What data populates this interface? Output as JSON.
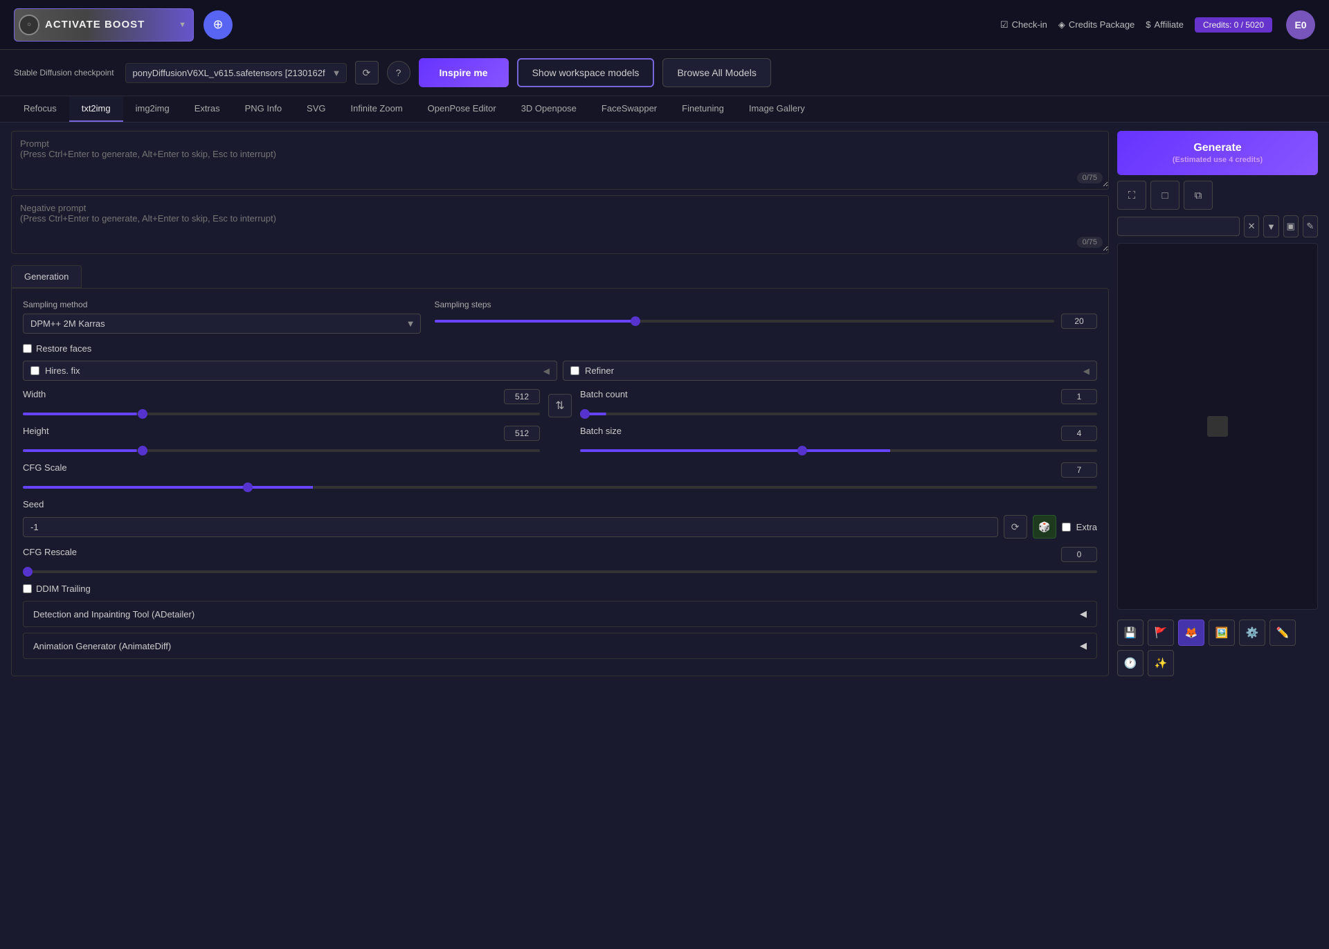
{
  "topbar": {
    "boost_label": "ACTIVATE BOOST",
    "discord_icon": "D",
    "checkin_label": "Check-in",
    "credits_package_label": "Credits Package",
    "affiliate_label": "Affiliate",
    "credits_label": "Credits: 0 / 5020",
    "avatar_label": "E0"
  },
  "checkpoint": {
    "label": "Stable Diffusion checkpoint",
    "value": "ponyDiffusionV6XL_v615.safetensors [2130162f",
    "inspire_label": "Inspire me",
    "workspace_label": "Show workspace models",
    "browse_label": "Browse All Models"
  },
  "tabs": [
    {
      "id": "refocus",
      "label": "Refocus"
    },
    {
      "id": "txt2img",
      "label": "txt2img",
      "active": true
    },
    {
      "id": "img2img",
      "label": "img2img"
    },
    {
      "id": "extras",
      "label": "Extras"
    },
    {
      "id": "pnginfo",
      "label": "PNG Info"
    },
    {
      "id": "svg",
      "label": "SVG"
    },
    {
      "id": "infinitezoom",
      "label": "Infinite Zoom"
    },
    {
      "id": "openpose",
      "label": "OpenPose Editor"
    },
    {
      "id": "3dopenpose",
      "label": "3D Openpose"
    },
    {
      "id": "faceswapper",
      "label": "FaceSwapper"
    },
    {
      "id": "finetuning",
      "label": "Finetuning"
    },
    {
      "id": "imagegallery",
      "label": "Image Gallery"
    }
  ],
  "prompt": {
    "placeholder": "Prompt\n(Press Ctrl+Enter to generate, Alt+Enter to skip, Esc to interrupt)",
    "counter": "0/75"
  },
  "negative_prompt": {
    "placeholder": "Negative prompt\n(Press Ctrl+Enter to generate, Alt+Enter to skip, Esc to interrupt)",
    "counter": "0/75"
  },
  "generation": {
    "section_label": "Generation",
    "sampling_method_label": "Sampling method",
    "sampling_method_value": "DPM++ 2M Karras",
    "sampling_steps_label": "Sampling steps",
    "sampling_steps_value": "20",
    "sampling_steps_pct": "33",
    "restore_faces_label": "Restore faces",
    "hires_label": "Hires. fix",
    "refiner_label": "Refiner",
    "width_label": "Width",
    "width_value": "512",
    "width_pct": "20",
    "height_label": "Height",
    "height_value": "512",
    "height_pct": "20",
    "batch_count_label": "Batch count",
    "batch_count_value": "1",
    "batch_count_pct": "5",
    "batch_size_label": "Batch size",
    "batch_size_value": "4",
    "batch_size_pct": "60",
    "cfg_scale_label": "CFG Scale",
    "cfg_scale_value": "7",
    "cfg_scale_pct": "27",
    "seed_label": "Seed",
    "seed_value": "-1",
    "extra_label": "Extra",
    "cfg_rescale_label": "CFG Rescale",
    "cfg_rescale_value": "0",
    "cfg_rescale_pct": "0",
    "ddim_trailing_label": "DDIM Trailing",
    "adetailer_label": "Detection and Inpainting Tool (ADetailer)",
    "animatediff_label": "Animation Generator (AnimateDiff)"
  },
  "generate_btn": {
    "label": "Generate",
    "sublabel": "(Estimated use 4 credits)"
  },
  "canvas": {
    "placeholder": ""
  },
  "bottom_icons": [
    "💾",
    "🚩",
    "🦊",
    "🖼️",
    "⚙️",
    "✏️",
    "🕐",
    "✨"
  ]
}
